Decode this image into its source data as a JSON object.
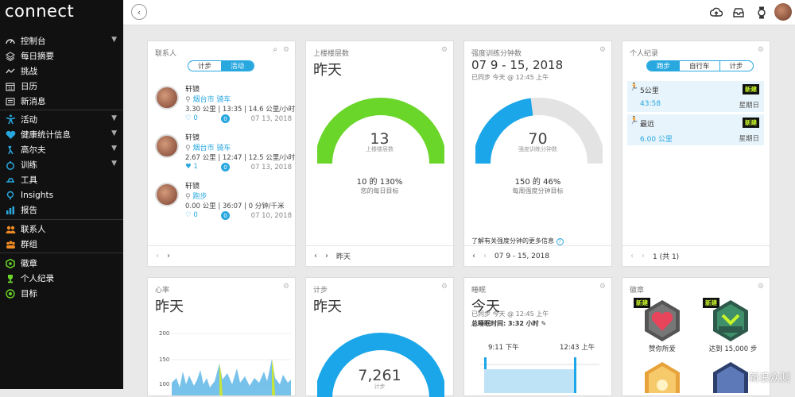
{
  "app": {
    "logo": "connect"
  },
  "sidebar": {
    "group1": [
      {
        "label": "控制台",
        "icon": "dashboard-icon",
        "chev": true
      },
      {
        "label": "每日摘要",
        "icon": "layers-icon",
        "chev": false
      },
      {
        "label": "挑战",
        "icon": "challenge-icon",
        "chev": false
      },
      {
        "label": "日历",
        "icon": "calendar-icon",
        "chev": false
      },
      {
        "label": "新消息",
        "icon": "news-icon",
        "chev": false
      }
    ],
    "group2": [
      {
        "label": "活动",
        "icon": "activity-icon",
        "chev": true
      },
      {
        "label": "健康统计信息",
        "icon": "heart-icon",
        "chev": true
      },
      {
        "label": "高尔夫",
        "icon": "golf-icon",
        "chev": true
      },
      {
        "label": "训练",
        "icon": "stopwatch-icon",
        "chev": true
      },
      {
        "label": "工具",
        "icon": "tools-icon",
        "chev": false
      },
      {
        "label": "Insights",
        "icon": "bulb-icon",
        "chev": false
      },
      {
        "label": "报告",
        "icon": "report-icon",
        "chev": false
      }
    ],
    "group3": [
      {
        "label": "联系人",
        "icon": "contacts-icon"
      },
      {
        "label": "群组",
        "icon": "groups-icon"
      }
    ],
    "group4": [
      {
        "label": "徽章",
        "icon": "badge-icon"
      },
      {
        "label": "个人纪录",
        "icon": "trophy-icon"
      },
      {
        "label": "目标",
        "icon": "target-icon"
      }
    ]
  },
  "colors": {
    "accent": "#29a8e0",
    "green": "#6bd62a",
    "gray": "#e3e3e3"
  },
  "contacts_card": {
    "title": "联系人",
    "seg": [
      "计步",
      "活动"
    ],
    "contacts": [
      {
        "name": "轩镜",
        "activity": "烟台市 骑车",
        "stats": "3.30 公里 | 13:35 | 14.6 公里/小时",
        "likes": "0",
        "badge": "0",
        "date": "07 13, 2018"
      },
      {
        "name": "轩镜",
        "activity": "烟台市 骑车",
        "stats": "2.67 公里 | 12:47 | 12.5 公里/小时",
        "likes": "1",
        "badge": "0",
        "date": "07 13, 2018"
      },
      {
        "name": "轩镜",
        "activity": "跑步",
        "stats": "0.00 公里 | 36:07 | 0 分钟/千米",
        "likes": "0",
        "badge": "0",
        "date": "07 10, 2018"
      }
    ]
  },
  "floors_card": {
    "title": "上楼楼层数",
    "period": "昨天",
    "value": "13",
    "value_label": "上楼楼层数",
    "goal_line": "10 的 130%",
    "goal_sub": "您的每日目标",
    "progress": 1.0,
    "foot": "昨天"
  },
  "intensity_card": {
    "title": "强度训练分钟数",
    "period": "07 9 - 15, 2018",
    "synced": "已同步 今天 @ 12:45 上午",
    "value": "70",
    "value_label": "强度训练分钟数",
    "goal_line": "150 的 46%",
    "goal_sub": "每周强度分钟目标",
    "progress": 0.46,
    "more": "了解有关强度分钟的更多信息",
    "foot": "07 9 - 15, 2018"
  },
  "records_card": {
    "title": "个人纪录",
    "seg": [
      "跑步",
      "自行车",
      "计步"
    ],
    "records": [
      {
        "name": "5公里",
        "value": "43:58",
        "when": "星期日",
        "tag": "新建"
      },
      {
        "name": "最远",
        "value": "6.00 公里",
        "when": "星期日",
        "tag": "新建"
      }
    ],
    "foot": "1 (共 1)"
  },
  "hr_card": {
    "title": "心率",
    "period": "昨天",
    "ticks": [
      "200",
      "150",
      "100"
    ]
  },
  "steps_card": {
    "title": "计步",
    "period": "昨天",
    "value": "7,261",
    "value_label": "计步"
  },
  "sleep_card": {
    "title": "睡眠",
    "period": "今天",
    "synced": "已同步 今天 @ 12:45 上午",
    "total": "总睡眠时间: 3:32 小时",
    "t1": "9:11 下午",
    "t2": "12:43 上午"
  },
  "badges_card": {
    "title": "徽章",
    "badges": [
      {
        "label": "赞你所爱",
        "tag": "新建"
      },
      {
        "label": "达到 15,000 步",
        "tag": "新建"
      }
    ]
  },
  "watermark": "新浪众测"
}
